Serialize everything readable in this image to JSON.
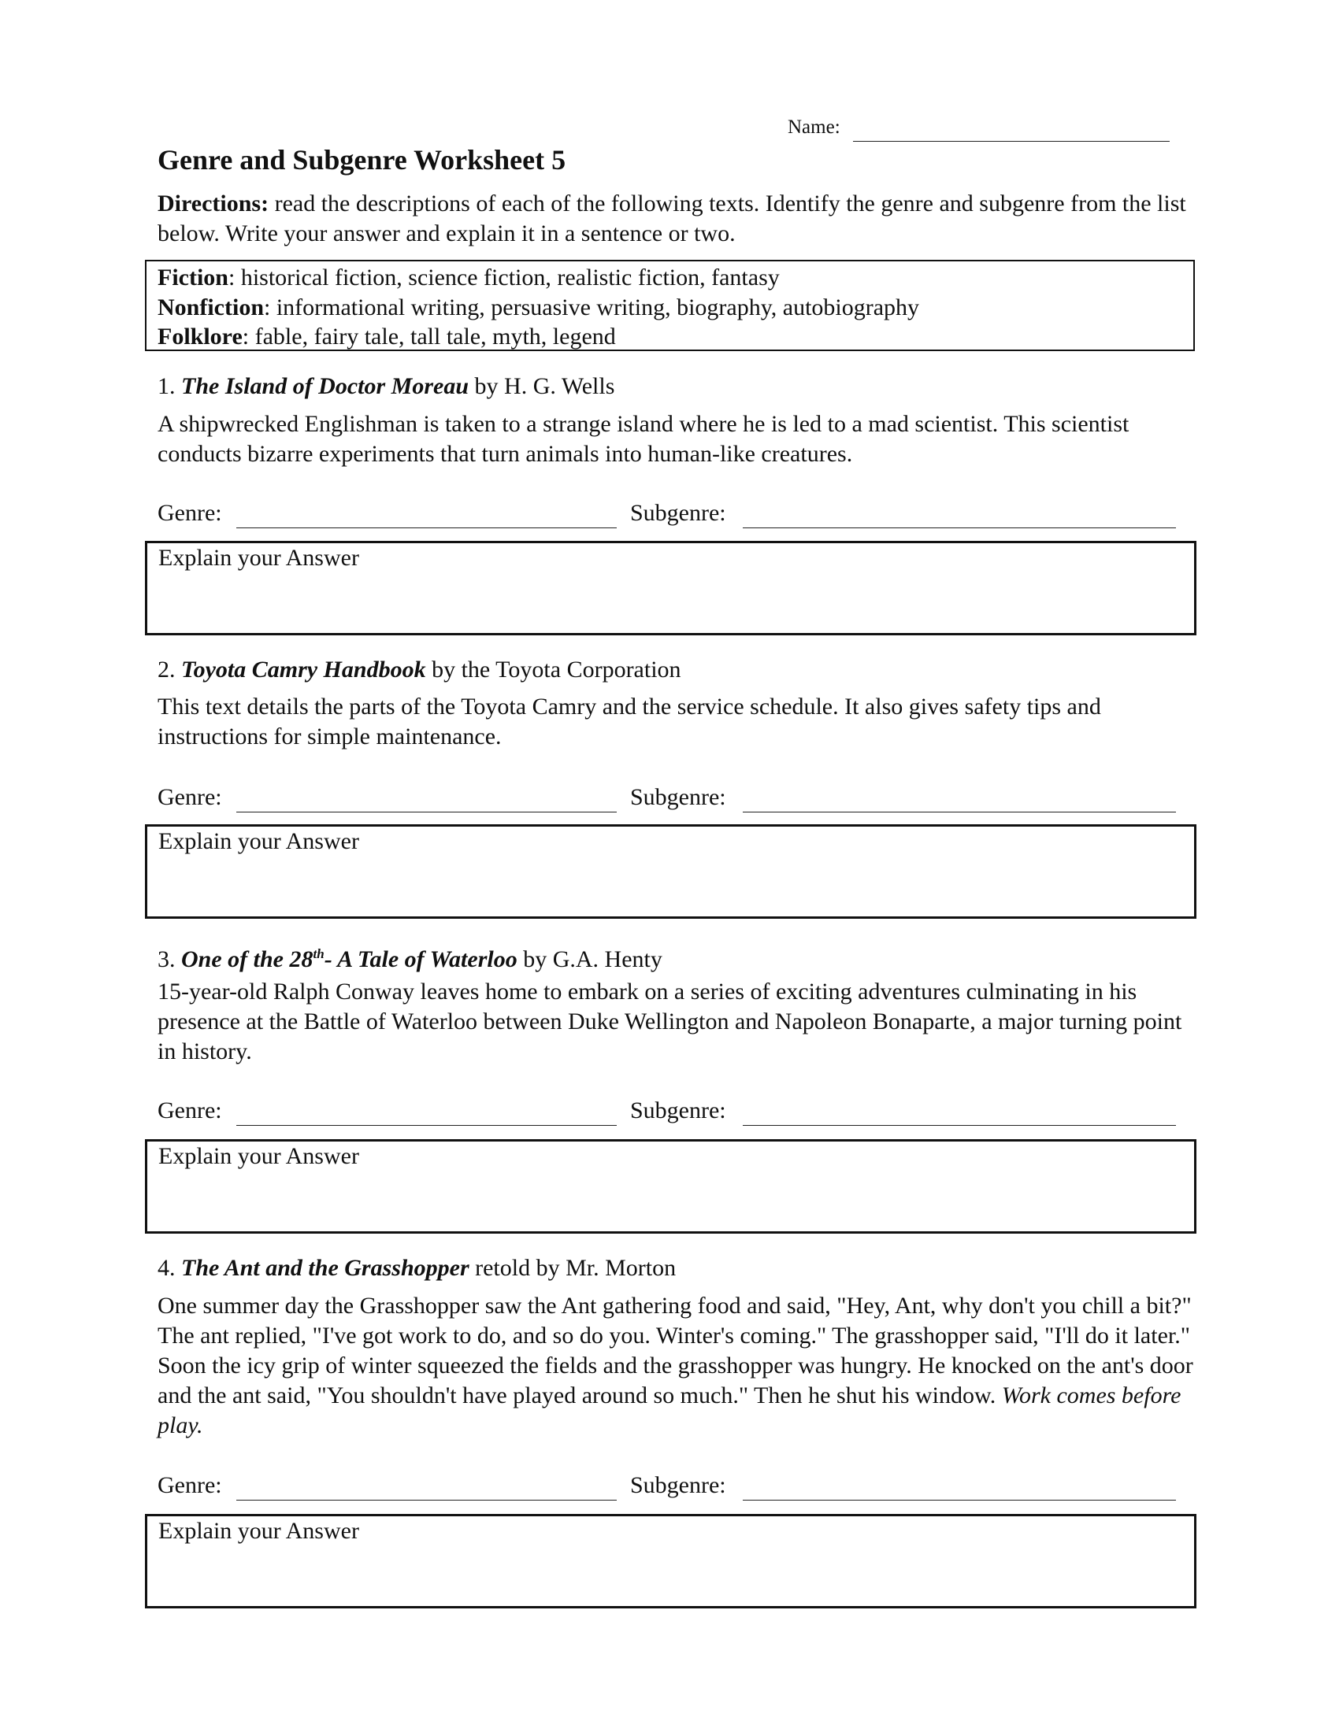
{
  "header": {
    "name_label": "Name:",
    "title": "Genre and Subgenre Worksheet 5",
    "directions_bold": "Directions:",
    "directions_text": " read the descriptions of each of the following texts. Identify the genre and subgenre from the list below. Write your answer and explain it in a sentence or two."
  },
  "legend": [
    {
      "genre": "Fiction",
      "subgenres": ": historical fiction, science fiction, realistic fiction, fantasy"
    },
    {
      "genre": "Nonfiction",
      "subgenres": ": informational writing, persuasive writing, biography, autobiography"
    },
    {
      "genre": "Folklore",
      "subgenres": ": fable, fairy tale, tall tale, myth, legend"
    }
  ],
  "labels": {
    "genre": "Genre:",
    "subgenre": "Subgenre:",
    "explain": "Explain your Answer"
  },
  "items": [
    {
      "number": "1.",
      "title": "The Island of Doctor Moreau",
      "byline": " by H. G. Wells",
      "description": "A shipwrecked Englishman is taken to a strange island where he is led to a mad scientist. This scientist conducts bizarre experiments that turn animals into human-like creatures."
    },
    {
      "number": "2.",
      "title": "Toyota Camry Handbook",
      "byline": " by the Toyota Corporation",
      "description": "This text details the parts of the Toyota Camry and the service schedule. It also gives safety tips and instructions for simple maintenance."
    },
    {
      "number": "3.",
      "title_part1": "One of the 28",
      "title_sup": "th",
      "title_part2": "- A Tale of Waterloo",
      "byline": " by G.A. Henty",
      "description": "15-year-old Ralph Conway leaves home to embark on a series of exciting adventures culminating in his presence at the Battle of Waterloo between Duke Wellington and Napoleon Bonaparte, a major turning point in history."
    },
    {
      "number": "4.",
      "title": "The Ant and the Grasshopper",
      "byline": " retold by Mr. Morton",
      "description": "One summer day the Grasshopper saw the Ant gathering food and said, \"Hey, Ant, why don't you chill a bit?\" The ant replied, \"I've got work to do, and so do you. Winter's coming.\" The grasshopper said, \"I'll do it later.\" Soon the icy grip of winter squeezed the fields and the grasshopper was hungry. He knocked on the ant's door and the ant said, \"You shouldn't have played around so much.\" Then he shut his window. ",
      "moral": "Work comes before play."
    }
  ]
}
